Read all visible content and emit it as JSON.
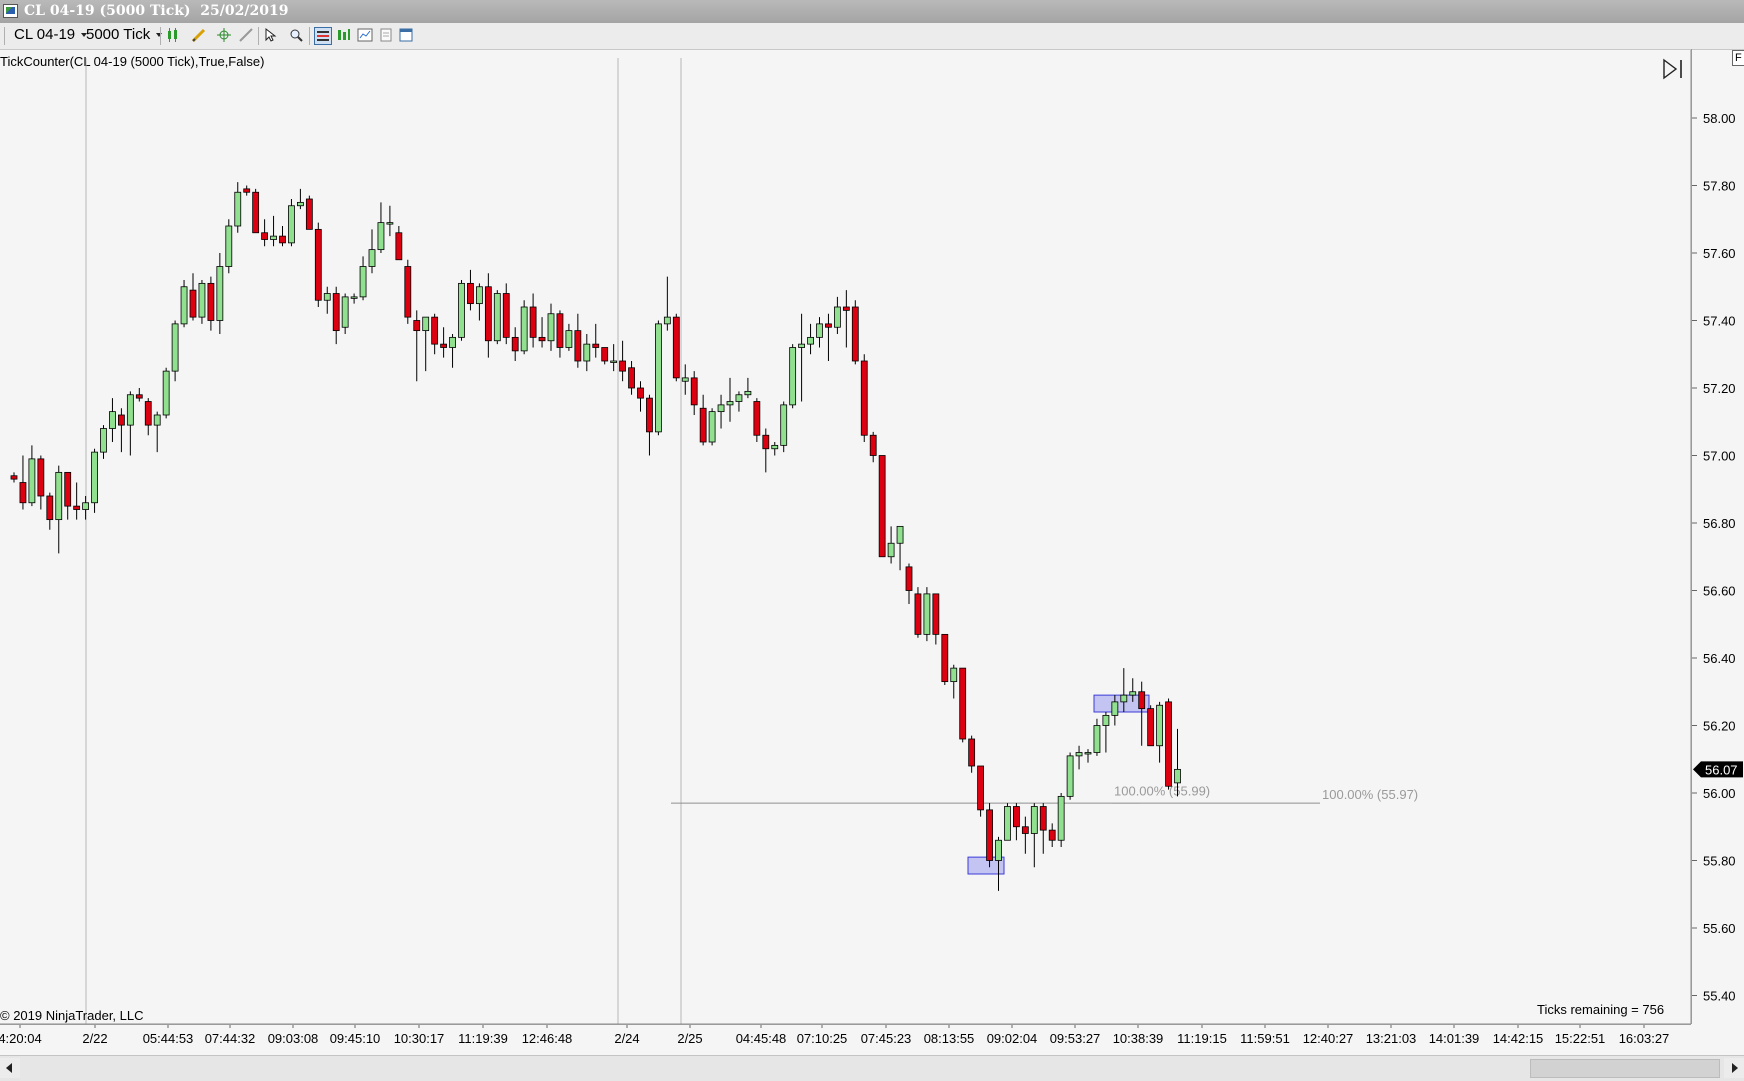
{
  "window": {
    "title": "CL 04-19 (5000 Tick)  25/02/2019"
  },
  "toolbar": {
    "instrument": "CL 04-19",
    "interval": "5000 Tick"
  },
  "indicator_label": "TickCounter(CL 04-19 (5000 Tick),True,False)",
  "copyright": "© 2019 NinjaTrader, LLC",
  "ticks_remaining": "Ticks remaining = 756",
  "colors": {
    "up": "#90e090",
    "down": "#dd0011",
    "zone": "#9b9bf0",
    "background": "#f5f5f5",
    "price_marker": "#000000"
  },
  "icons": [
    "candlestick-icon",
    "pencil-icon",
    "crosshair-icon",
    "pointer-icon",
    "zoom-icon",
    "properties-icon",
    "indicator-icon",
    "strategy-icon",
    "data-box-icon",
    "window-icon",
    "scroll-end-icon"
  ],
  "chart_data": {
    "type": "candlestick",
    "y_range": [
      55.35,
      58.1
    ],
    "y_ticks": [
      "58.00",
      "57.80",
      "57.60",
      "57.40",
      "57.20",
      "57.00",
      "56.80",
      "56.60",
      "56.40",
      "56.20",
      "56.00",
      "55.80",
      "55.60",
      "55.40"
    ],
    "last_price": "56.07",
    "x_labels": [
      "4:20:04",
      "2/22",
      "05:44:53",
      "07:44:32",
      "09:03:08",
      "09:45:10",
      "10:30:17",
      "11:19:39",
      "12:46:48",
      "2/24",
      "2/25",
      "04:45:48",
      "07:10:25",
      "07:45:23",
      "08:13:55",
      "09:02:04",
      "09:53:27",
      "10:38:39",
      "11:19:15",
      "11:59:51",
      "12:40:27",
      "13:21:03",
      "14:01:39",
      "14:42:15",
      "15:22:51",
      "16:03:27"
    ],
    "session_breaks": [
      "2/22",
      "2/24",
      "2/25"
    ],
    "candles": [
      [
        56.94,
        56.95,
        56.92,
        56.93
      ],
      [
        56.92,
        57.0,
        56.84,
        56.86
      ],
      [
        56.86,
        57.03,
        56.85,
        56.99
      ],
      [
        56.99,
        57.0,
        56.84,
        56.88
      ],
      [
        56.88,
        56.89,
        56.78,
        56.81
      ],
      [
        56.81,
        56.97,
        56.71,
        56.95
      ],
      [
        56.95,
        56.95,
        56.81,
        56.85
      ],
      [
        56.85,
        56.92,
        56.81,
        56.84
      ],
      [
        56.84,
        56.88,
        56.81,
        56.86
      ],
      [
        56.86,
        57.02,
        56.83,
        57.01
      ],
      [
        57.01,
        57.09,
        56.99,
        57.08
      ],
      [
        57.08,
        57.17,
        57.04,
        57.13
      ],
      [
        57.12,
        57.14,
        57.01,
        57.09
      ],
      [
        57.09,
        57.19,
        57.0,
        57.18
      ],
      [
        57.18,
        57.2,
        57.16,
        57.17
      ],
      [
        57.16,
        57.17,
        57.06,
        57.09
      ],
      [
        57.09,
        57.13,
        57.01,
        57.12
      ],
      [
        57.12,
        57.26,
        57.11,
        57.25
      ],
      [
        57.25,
        57.4,
        57.22,
        57.39
      ],
      [
        57.39,
        57.52,
        57.38,
        57.5
      ],
      [
        57.49,
        57.54,
        57.4,
        57.41
      ],
      [
        57.41,
        57.52,
        57.39,
        57.51
      ],
      [
        57.51,
        57.53,
        57.37,
        57.4
      ],
      [
        57.4,
        57.6,
        57.36,
        57.56
      ],
      [
        57.56,
        57.7,
        57.54,
        57.68
      ],
      [
        57.68,
        57.81,
        57.66,
        57.78
      ],
      [
        57.79,
        57.8,
        57.77,
        57.78
      ],
      [
        57.78,
        57.79,
        57.66,
        57.66
      ],
      [
        57.66,
        57.7,
        57.62,
        57.64
      ],
      [
        57.64,
        57.71,
        57.62,
        57.65
      ],
      [
        57.65,
        57.68,
        57.62,
        57.63
      ],
      [
        57.63,
        57.76,
        57.62,
        57.74
      ],
      [
        57.74,
        57.79,
        57.73,
        57.75
      ],
      [
        57.76,
        57.77,
        57.67,
        57.67
      ],
      [
        57.67,
        57.69,
        57.44,
        57.46
      ],
      [
        57.46,
        57.5,
        57.42,
        57.48
      ],
      [
        57.48,
        57.5,
        57.33,
        57.37
      ],
      [
        57.38,
        57.48,
        57.36,
        57.47
      ],
      [
        57.47,
        57.48,
        57.45,
        57.47
      ],
      [
        57.47,
        57.59,
        57.46,
        57.56
      ],
      [
        57.56,
        57.67,
        57.54,
        57.61
      ],
      [
        57.61,
        57.75,
        57.6,
        57.69
      ],
      [
        57.69,
        57.74,
        57.65,
        57.69
      ],
      [
        57.66,
        57.68,
        57.58,
        57.58
      ],
      [
        57.56,
        57.58,
        57.39,
        57.41
      ],
      [
        57.4,
        57.43,
        57.22,
        57.37
      ],
      [
        57.37,
        57.41,
        57.25,
        57.41
      ],
      [
        57.41,
        57.42,
        57.3,
        57.33
      ],
      [
        57.33,
        57.38,
        57.29,
        57.32
      ],
      [
        57.32,
        57.36,
        57.26,
        57.35
      ],
      [
        57.35,
        57.52,
        57.34,
        57.51
      ],
      [
        57.51,
        57.55,
        57.43,
        57.45
      ],
      [
        57.45,
        57.51,
        57.4,
        57.5
      ],
      [
        57.5,
        57.54,
        57.29,
        57.34
      ],
      [
        57.34,
        57.49,
        57.33,
        57.48
      ],
      [
        57.48,
        57.51,
        57.33,
        57.35
      ],
      [
        57.35,
        57.38,
        57.28,
        57.31
      ],
      [
        57.31,
        57.46,
        57.3,
        57.44
      ],
      [
        57.44,
        57.48,
        57.32,
        57.35
      ],
      [
        57.35,
        57.41,
        57.32,
        57.34
      ],
      [
        57.34,
        57.45,
        57.31,
        57.42
      ],
      [
        57.42,
        57.43,
        57.29,
        57.32
      ],
      [
        57.32,
        57.39,
        57.31,
        57.37
      ],
      [
        57.37,
        57.42,
        57.26,
        57.28
      ],
      [
        57.28,
        57.36,
        57.25,
        57.33
      ],
      [
        57.33,
        57.39,
        57.29,
        57.32
      ],
      [
        57.32,
        57.32,
        57.27,
        57.28
      ],
      [
        57.28,
        57.33,
        57.25,
        57.28
      ],
      [
        57.28,
        57.34,
        57.22,
        57.25
      ],
      [
        57.26,
        57.28,
        57.18,
        57.2
      ],
      [
        57.2,
        57.22,
        57.13,
        57.17
      ],
      [
        57.17,
        57.18,
        57.0,
        57.07
      ],
      [
        57.07,
        57.4,
        57.06,
        57.39
      ],
      [
        57.39,
        57.53,
        57.37,
        57.41
      ],
      [
        57.41,
        57.42,
        57.22,
        57.23
      ],
      [
        57.22,
        57.27,
        57.18,
        57.23
      ],
      [
        57.23,
        57.25,
        57.12,
        57.15
      ],
      [
        57.14,
        57.18,
        57.03,
        57.04
      ],
      [
        57.04,
        57.14,
        57.03,
        57.13
      ],
      [
        57.13,
        57.18,
        57.08,
        57.15
      ],
      [
        57.15,
        57.23,
        57.1,
        57.16
      ],
      [
        57.16,
        57.19,
        57.13,
        57.18
      ],
      [
        57.18,
        57.23,
        57.17,
        57.19
      ],
      [
        57.16,
        57.17,
        57.04,
        57.06
      ],
      [
        57.06,
        57.08,
        56.95,
        57.02
      ],
      [
        57.02,
        57.04,
        57.0,
        57.03
      ],
      [
        57.03,
        57.16,
        57.01,
        57.15
      ],
      [
        57.15,
        57.33,
        57.14,
        57.32
      ],
      [
        57.32,
        57.42,
        57.16,
        57.33
      ],
      [
        57.33,
        57.39,
        57.3,
        57.35
      ],
      [
        57.35,
        57.41,
        57.32,
        57.39
      ],
      [
        57.39,
        57.42,
        57.28,
        57.38
      ],
      [
        57.38,
        57.47,
        57.36,
        57.44
      ],
      [
        57.44,
        57.49,
        57.32,
        57.43
      ],
      [
        57.44,
        57.46,
        57.27,
        57.28
      ],
      [
        57.28,
        57.3,
        57.04,
        57.06
      ],
      [
        57.06,
        57.07,
        56.98,
        57.0
      ],
      [
        57.0,
        57.0,
        56.79,
        56.7
      ],
      [
        56.7,
        56.79,
        56.68,
        56.74
      ],
      [
        56.74,
        56.77,
        56.66,
        56.79
      ],
      [
        56.67,
        56.68,
        56.56,
        56.6
      ],
      [
        56.59,
        56.61,
        56.46,
        56.47
      ],
      [
        56.47,
        56.61,
        56.45,
        56.59
      ],
      [
        56.59,
        56.59,
        56.44,
        56.47
      ],
      [
        56.47,
        56.46,
        56.32,
        56.33
      ],
      [
        56.33,
        56.38,
        56.28,
        56.37
      ],
      [
        56.37,
        56.37,
        56.15,
        56.16
      ],
      [
        56.16,
        56.17,
        56.06,
        56.08
      ],
      [
        56.08,
        56.08,
        55.93,
        55.95
      ],
      [
        55.95,
        55.97,
        55.78,
        55.8
      ],
      [
        55.8,
        55.87,
        55.71,
        55.86
      ],
      [
        55.86,
        55.97,
        55.86,
        55.96
      ],
      [
        55.96,
        55.97,
        55.86,
        55.9
      ],
      [
        55.9,
        55.93,
        55.82,
        55.88
      ],
      [
        55.88,
        55.97,
        55.78,
        55.96
      ],
      [
        55.96,
        55.97,
        55.82,
        55.89
      ],
      [
        55.89,
        55.91,
        55.84,
        55.86
      ],
      [
        55.86,
        56.0,
        55.84,
        55.99
      ],
      [
        55.99,
        56.12,
        55.98,
        56.11
      ],
      [
        56.11,
        56.14,
        56.07,
        56.12
      ],
      [
        56.12,
        56.13,
        56.09,
        56.12
      ],
      [
        56.12,
        56.22,
        56.11,
        56.2
      ],
      [
        56.2,
        56.24,
        56.12,
        56.23
      ],
      [
        56.23,
        56.29,
        56.2,
        56.27
      ],
      [
        56.27,
        56.37,
        56.24,
        56.29
      ],
      [
        56.29,
        56.34,
        56.27,
        56.3
      ],
      [
        56.3,
        56.33,
        56.14,
        56.25
      ],
      [
        56.25,
        56.26,
        56.16,
        56.14
      ],
      [
        56.14,
        56.27,
        56.09,
        56.26
      ],
      [
        56.27,
        56.28,
        56.01,
        56.02
      ],
      [
        56.03,
        56.19,
        55.99,
        56.07
      ]
    ],
    "zones": [
      {
        "type": "demand",
        "x_label": "09:02:04",
        "low": 55.76,
        "high": 55.81
      },
      {
        "type": "supply",
        "x_label": "10:38:39",
        "low": 56.24,
        "high": 56.29
      }
    ],
    "levels": [
      {
        "value": 55.97,
        "label": "100.00% (55.97)"
      },
      {
        "value": 55.99,
        "label": "100.00% (55.99)"
      }
    ]
  }
}
